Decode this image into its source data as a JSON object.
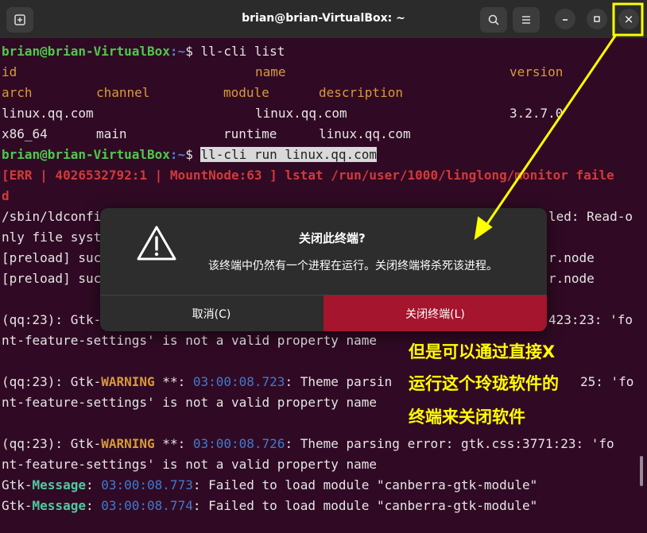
{
  "window": {
    "title": "brian@brian-VirtualBox: ~"
  },
  "titlebar": {
    "new_tab_icon": "new-tab-icon",
    "search_icon": "search-icon",
    "menu_icon": "hamburger-icon",
    "minimize_icon": "minimize-icon",
    "maximize_icon": "maximize-icon",
    "close_glyph": "×"
  },
  "terminal": {
    "user_host": "brian@brian-VirtualBox",
    "path_sep": ":~$ ",
    "cmd1": "ll-cli list",
    "hdr_id": "id",
    "hdr_name": "name",
    "hdr_version": "version",
    "hdr_arch": "arch",
    "hdr_channel": "channel",
    "hdr_module": "module",
    "hdr_description": "description",
    "row_id": "linux.qq.com",
    "row_name": "linux.qq.com",
    "row_version": "3.2.7.0",
    "row_arch": "x86_64",
    "row_channel": "main",
    "row_module": "runtime",
    "row_description": "linux.qq.com",
    "cmd2": "ll-cli run linux.qq.com",
    "err_line1": "[ERR | 4026532792:1 | MountNode:63 ] lstat /run/user/1000/linglong/monitor faile",
    "err_line2": "d",
    "ld_l1_a": "/sbin/ldconfi",
    "ld_l1_b": "led: Read-o",
    "ld_l2": "nly file syst",
    "pre1_a": "[preload] suc",
    "pre1_b": "r.node",
    "pre2_a": "[preload] suc",
    "pre2_b": "r.node",
    "gtk1_a": "(qq:23): Gtk-",
    "gtk1_b": "423:23: 'fo",
    "gtk1_l2": "nt-feature-settings' is not a valid property name",
    "gtk2_prefix": "(qq:23): Gtk-",
    "warning": "WARNING",
    "stars": " **: ",
    "ts2": "03:00:08.723",
    "gtk2_mid": ": Theme parsin",
    "gtk2_end": "25: 'fo",
    "gtk2_l2": "nt-feature-settings' is not a valid property name",
    "ts3": "03:00:08.726",
    "gtk3_rest": ": Theme parsing error: gtk.css:3771:23: 'fo",
    "gtk3_l2": "nt-feature-settings' is not a valid property name",
    "gtk_msg_prefix": "Gtk-",
    "message": "Message",
    "colon": ": ",
    "ts4": "03:00:08.773",
    "ts5": "03:00:08.774",
    "msg_rest": ": Failed to load module \"canberra-gtk-module\""
  },
  "dialog": {
    "title": "关闭此终端?",
    "message": "该终端中仍然有一个进程在运行。关闭终端将杀死该进程。",
    "cancel_label": "取消(C)",
    "close_label": "关闭终端(L)",
    "icon": "warning-triangle-icon"
  },
  "annotation": {
    "line1": "但是可以通过直接X",
    "line2": "运行这个玲珑软件的",
    "line3": "终端来关闭软件",
    "color": "#ffff00"
  },
  "colors": {
    "background": "#300a24",
    "prompt_user": "#4ec94e",
    "prompt_path": "#4a84d6",
    "error": "#d23a3a",
    "header": "#d89a3a",
    "close_button": "#a5152d"
  }
}
